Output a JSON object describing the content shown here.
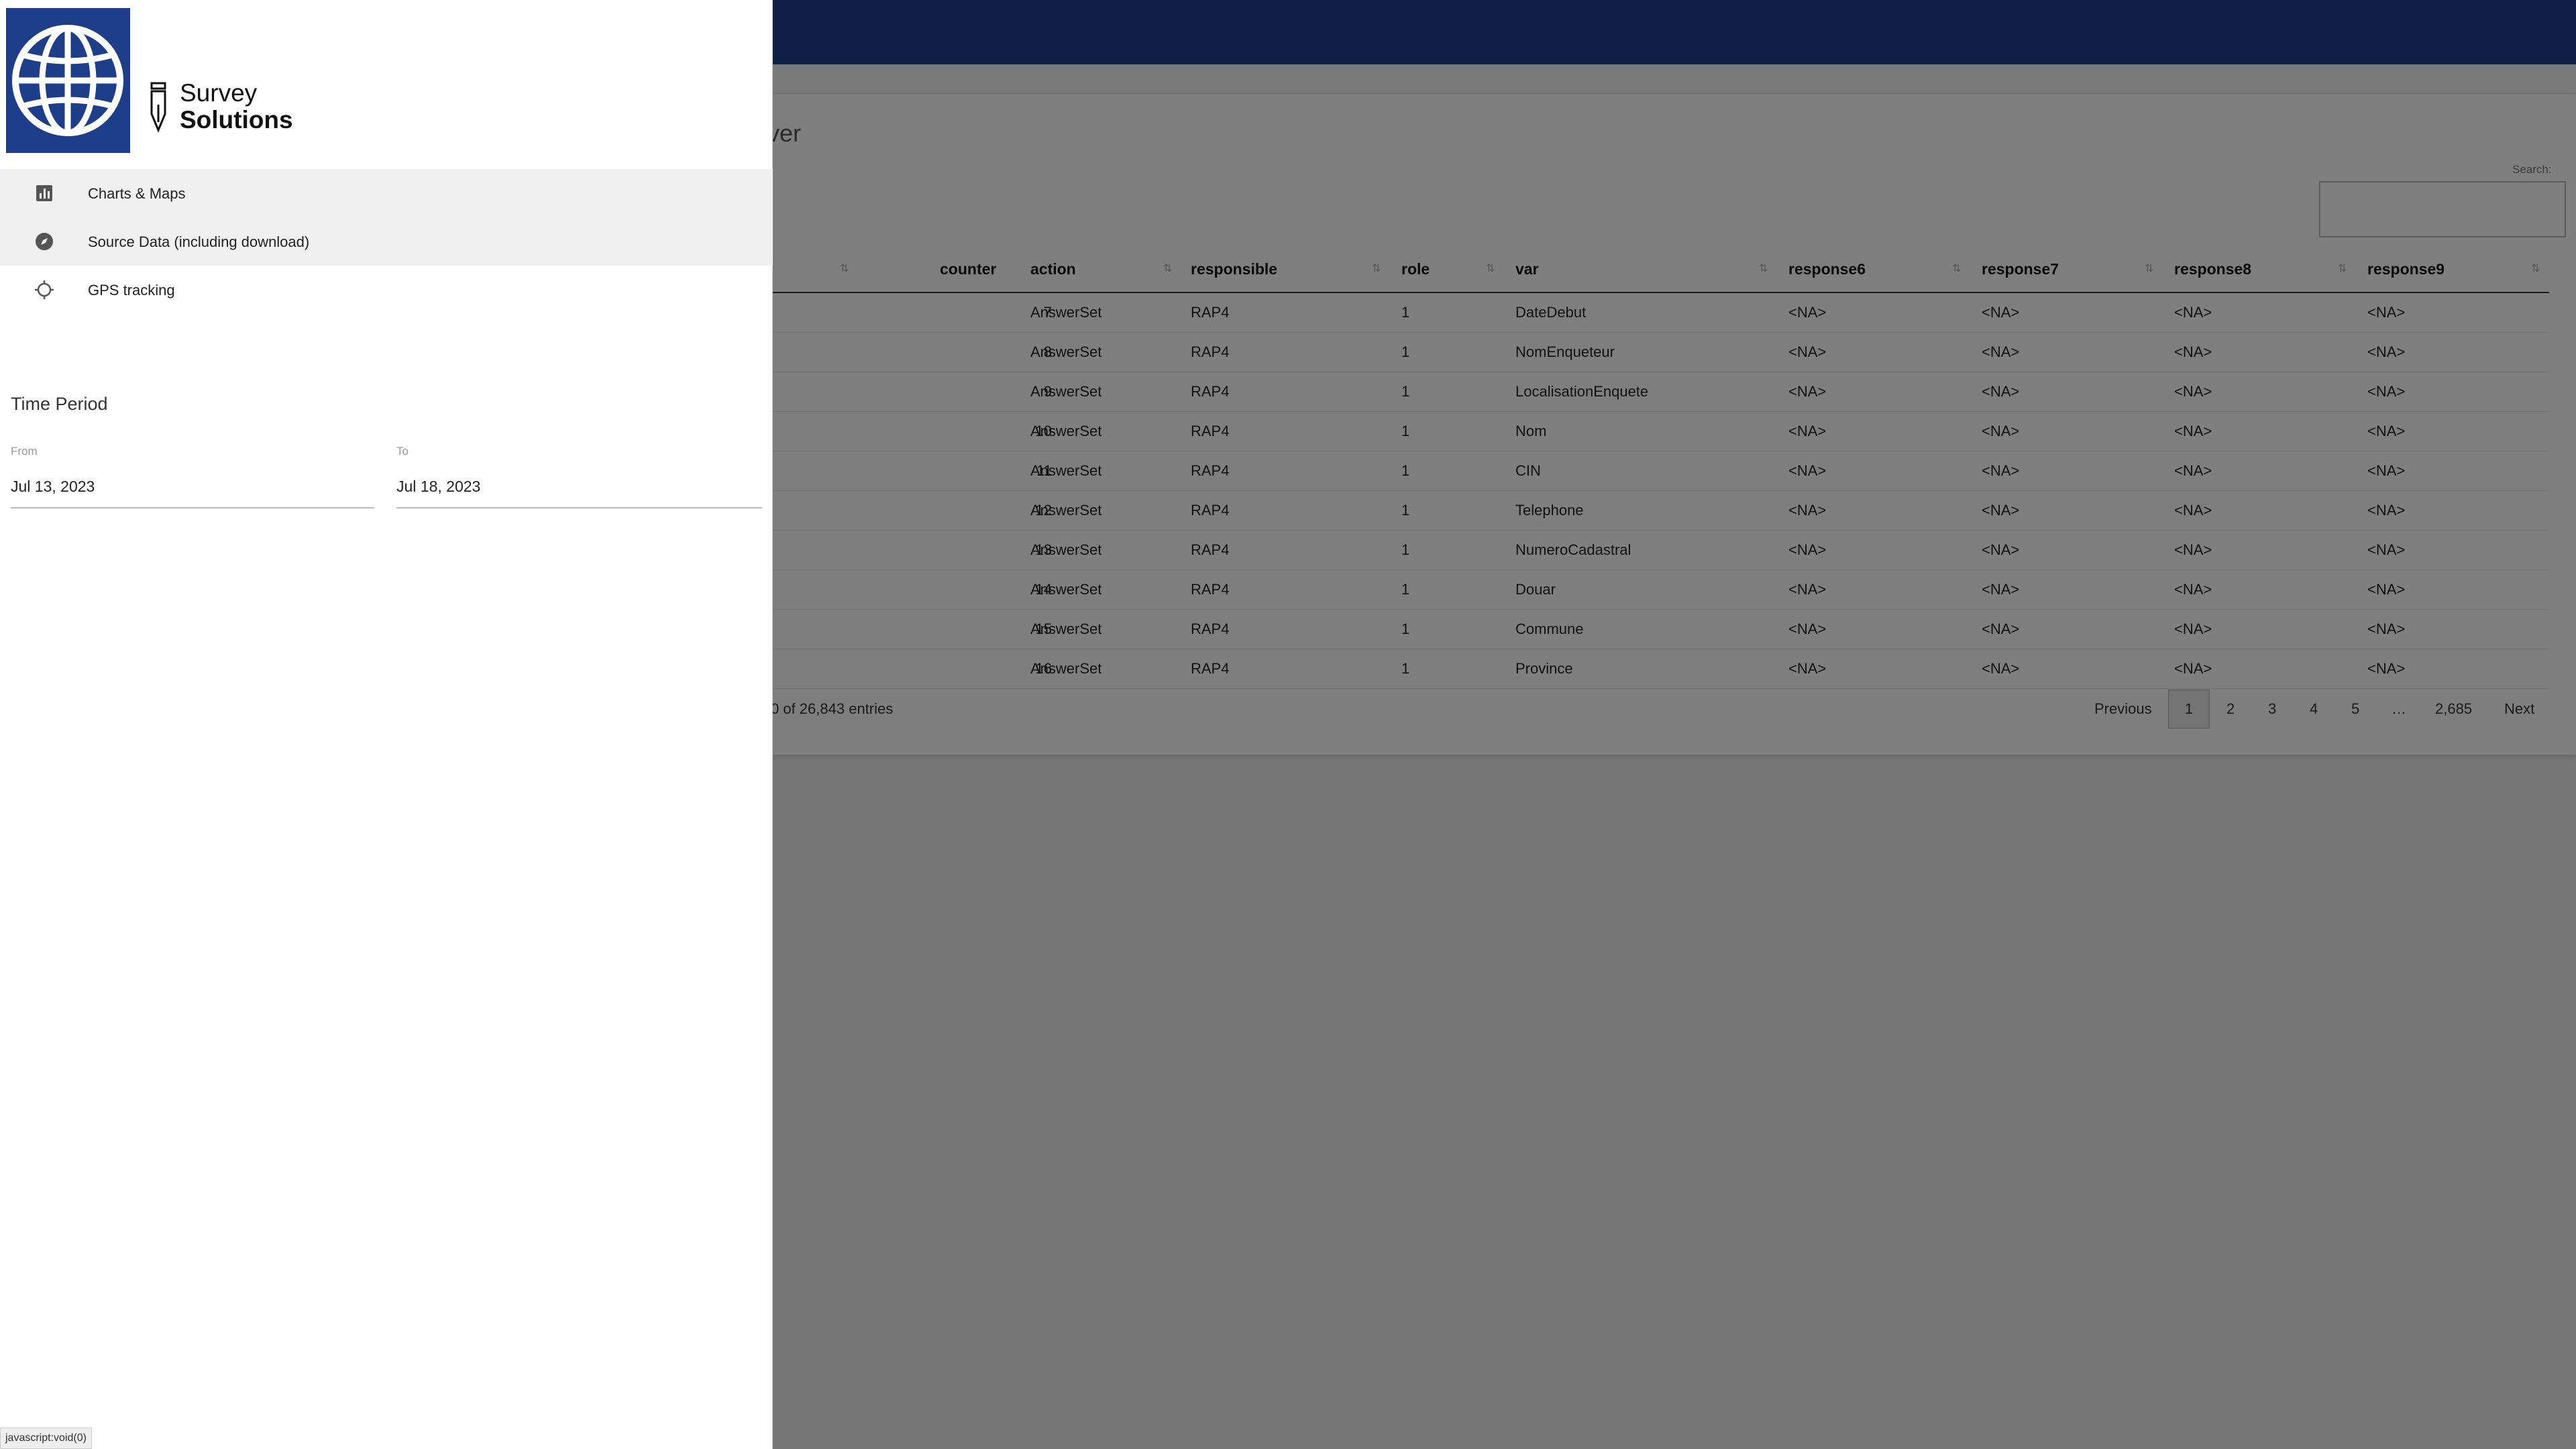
{
  "page": {
    "heading_fragment": "ver"
  },
  "search": {
    "label": "Search:",
    "value": ""
  },
  "table": {
    "columns": [
      "counter",
      "action",
      "responsible",
      "role",
      "var",
      "response6",
      "response7",
      "response8",
      "response9"
    ],
    "rows": [
      {
        "counter": "7",
        "action": "AnswerSet",
        "responsible": "RAP4",
        "role": "1",
        "var": "DateDebut",
        "response6": "<NA>",
        "response7": "<NA>",
        "response8": "<NA>",
        "response9": "<NA>"
      },
      {
        "counter": "8",
        "action": "AnswerSet",
        "responsible": "RAP4",
        "role": "1",
        "var": "NomEnqueteur",
        "response6": "<NA>",
        "response7": "<NA>",
        "response8": "<NA>",
        "response9": "<NA>"
      },
      {
        "counter": "9",
        "action": "AnswerSet",
        "responsible": "RAP4",
        "role": "1",
        "var": "LocalisationEnquete",
        "response6": "<NA>",
        "response7": "<NA>",
        "response8": "<NA>",
        "response9": "<NA>"
      },
      {
        "counter": "10",
        "action": "AnswerSet",
        "responsible": "RAP4",
        "role": "1",
        "var": "Nom",
        "response6": "<NA>",
        "response7": "<NA>",
        "response8": "<NA>",
        "response9": "<NA>"
      },
      {
        "counter": "11",
        "action": "AnswerSet",
        "responsible": "RAP4",
        "role": "1",
        "var": "CIN",
        "response6": "<NA>",
        "response7": "<NA>",
        "response8": "<NA>",
        "response9": "<NA>"
      },
      {
        "counter": "12",
        "action": "AnswerSet",
        "responsible": "RAP4",
        "role": "1",
        "var": "Telephone",
        "response6": "<NA>",
        "response7": "<NA>",
        "response8": "<NA>",
        "response9": "<NA>"
      },
      {
        "counter": "13",
        "action": "AnswerSet",
        "responsible": "RAP4",
        "role": "1",
        "var": "NumeroCadastral",
        "response6": "<NA>",
        "response7": "<NA>",
        "response8": "<NA>",
        "response9": "<NA>"
      },
      {
        "counter": "14",
        "action": "AnswerSet",
        "responsible": "RAP4",
        "role": "1",
        "var": "Douar",
        "response6": "<NA>",
        "response7": "<NA>",
        "response8": "<NA>",
        "response9": "<NA>"
      },
      {
        "counter": "15",
        "action": "AnswerSet",
        "responsible": "RAP4",
        "role": "1",
        "var": "Commune",
        "response6": "<NA>",
        "response7": "<NA>",
        "response8": "<NA>",
        "response9": "<NA>"
      },
      {
        "counter": "16",
        "action": "AnswerSet",
        "responsible": "RAP4",
        "role": "1",
        "var": "Province",
        "response6": "<NA>",
        "response7": "<NA>",
        "response8": "<NA>",
        "response9": "<NA>"
      }
    ],
    "info": "0 of 26,843 entries"
  },
  "pagination": {
    "previous": "Previous",
    "pages": [
      "1",
      "2",
      "3",
      "4",
      "5"
    ],
    "ellipsis": "…",
    "last": "2,685",
    "next": "Next",
    "current": "1"
  },
  "drawer": {
    "brand_line1": "Survey",
    "brand_line2": "Solutions",
    "nav": [
      {
        "label": "Charts & Maps",
        "icon": "bar-chart-icon"
      },
      {
        "label": "Source Data (including download)",
        "icon": "compass-icon"
      },
      {
        "label": "GPS tracking",
        "icon": "gps-crosshair-icon"
      }
    ],
    "time_period": {
      "title": "Time Period",
      "from_label": "From",
      "from_value": "Jul 13, 2023",
      "to_label": "To",
      "to_value": "Jul 18, 2023"
    }
  },
  "statusbar": {
    "text": "javascript:void(0)"
  },
  "colors": {
    "brand_blue": "#1f3e8a",
    "overlay": "rgba(0,0,0,0.5)"
  }
}
